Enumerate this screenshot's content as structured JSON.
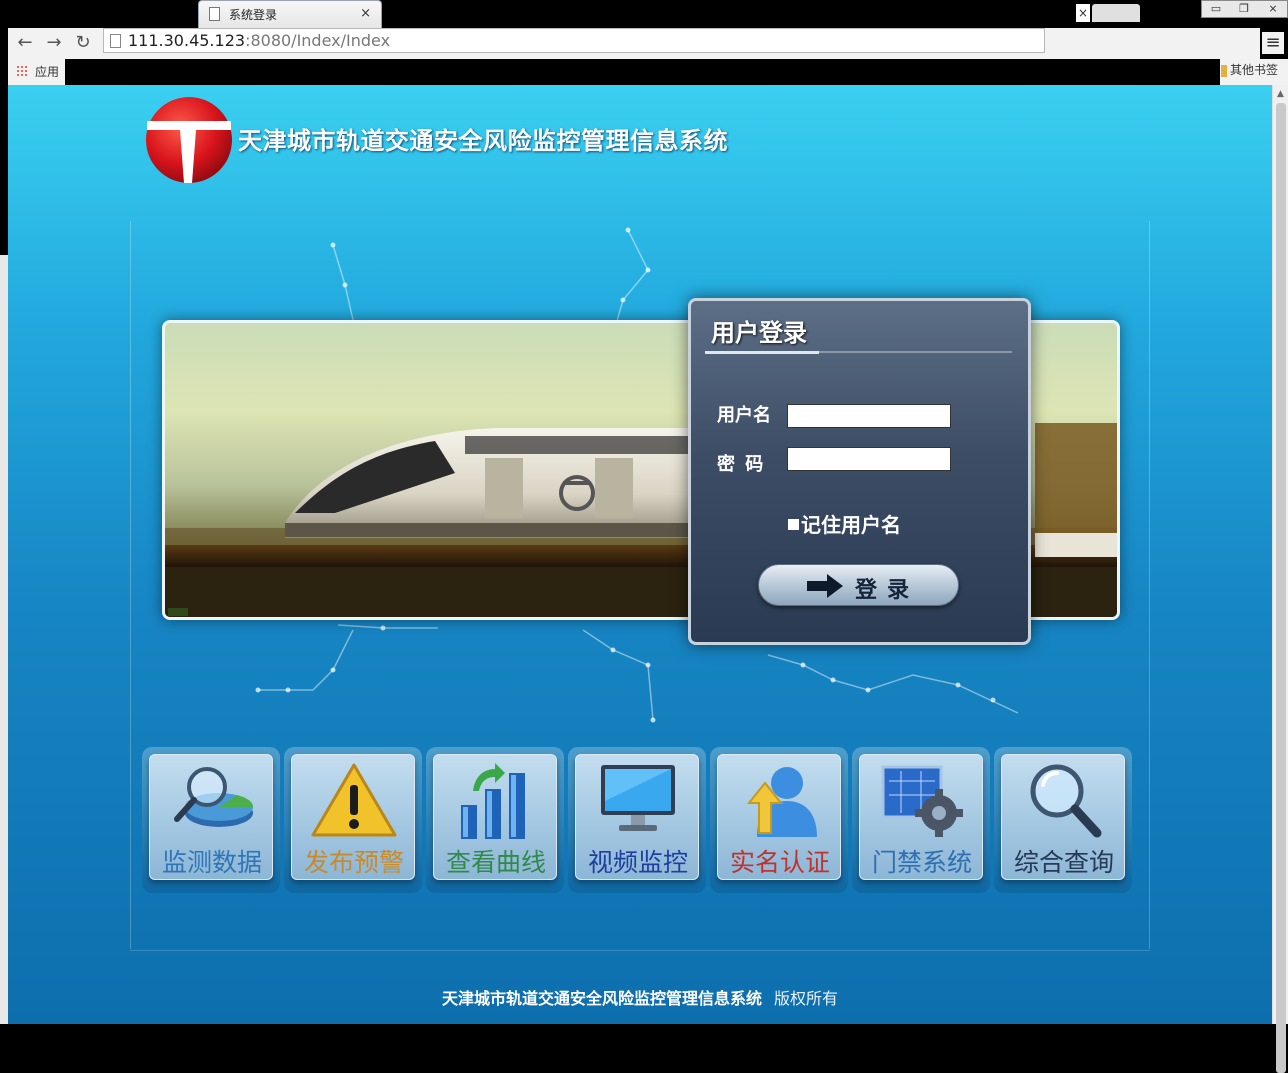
{
  "browser": {
    "tab_title": "系统登录",
    "tab_close": "×",
    "tab2_close": "×",
    "url_host": "111.30.45.123",
    "url_rest": ":8080/Index/Index",
    "bookmark_apps": "应用",
    "bookmark_other": "其他书签",
    "win_minimize": "▭",
    "win_restore": "❐",
    "win_close": "⨯",
    "nav_back": "←",
    "nav_forward": "→",
    "nav_reload": "↻",
    "menu": "≡"
  },
  "header": {
    "system_title": "天津城市轨道交通安全风险监控管理信息系统"
  },
  "login": {
    "title": "用户登录",
    "username_label": "用户名",
    "username_value": "",
    "password_label": "密  码",
    "password_value": "",
    "remember_label": "记住用户名",
    "submit_label": "登录"
  },
  "modules": [
    {
      "label": "监测数据",
      "icon": "magnifier-pie-chart-icon",
      "color": "#2f76b8"
    },
    {
      "label": "发布预警",
      "icon": "warning-triangle-icon",
      "color": "#c88a2a"
    },
    {
      "label": "查看曲线",
      "icon": "bar-chart-arrow-icon",
      "color": "#2f8a4a"
    },
    {
      "label": "视频监控",
      "icon": "monitor-icon",
      "color": "#1f3fa0"
    },
    {
      "label": "实名认证",
      "icon": "user-upload-icon",
      "color": "#c0322c"
    },
    {
      "label": "门禁系统",
      "icon": "blueprint-gear-icon",
      "color": "#2f6fb0"
    },
    {
      "label": "综合查询",
      "icon": "search-magnifier-icon",
      "color": "#243a55"
    }
  ],
  "footer": {
    "system_name": "天津城市轨道交通安全风险监控管理信息系统",
    "rights": "版权所有"
  },
  "colors": {
    "page_top": "#3ad0f0",
    "page_bottom": "#0d6ead",
    "logo_red": "#d8141c",
    "panel": "#3c4d65"
  }
}
